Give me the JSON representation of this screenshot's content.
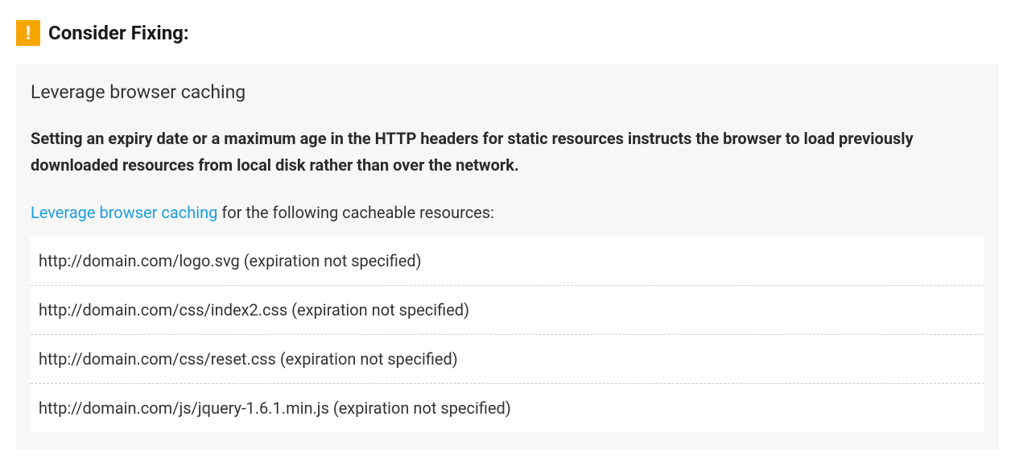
{
  "header": {
    "badge_glyph": "!",
    "title": "Consider Fixing:"
  },
  "rule": {
    "title": "Leverage browser caching",
    "description": "Setting an expiry date or a maximum age in the HTTP headers for static resources instructs the browser to load previously downloaded resources from local disk rather than over the network.",
    "intro_link_text": "Leverage browser caching",
    "intro_tail_text": " for the following cacheable resources:"
  },
  "resources": [
    "http://domain.com/logo.svg (expiration not specified)",
    "http://domain.com/css/index2.css (expiration not specified)",
    "http://domain.com/css/reset.css (expiration not specified)",
    "http://domain.com/js/jquery-1.6.1.min.js (expiration not specified)"
  ]
}
